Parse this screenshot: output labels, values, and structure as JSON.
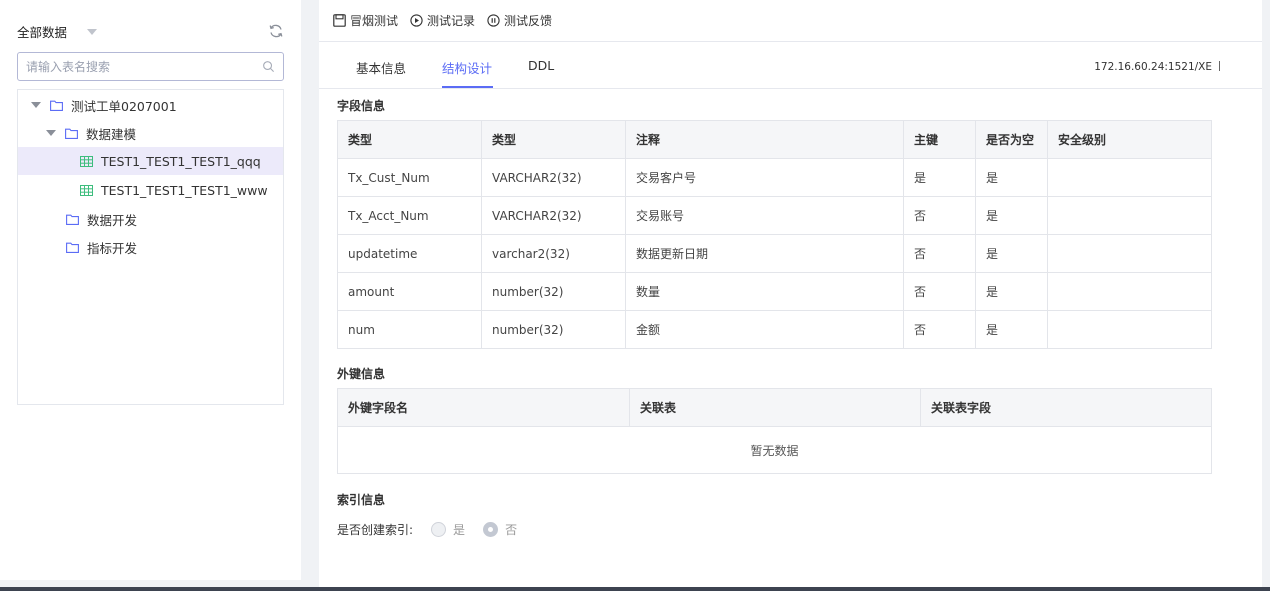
{
  "sidebar": {
    "scope_label": "全部数据",
    "search_placeholder": "请输入表名搜索",
    "tree": [
      {
        "label": "测试工单0207001",
        "type": "folder",
        "expanded": true
      },
      {
        "label": "数据建模",
        "type": "folder",
        "expanded": true
      },
      {
        "label": "TEST1_TEST1_TEST1_qqq",
        "type": "table",
        "selected": true
      },
      {
        "label": "TEST1_TEST1_TEST1_www",
        "type": "table"
      },
      {
        "label": "数据开发",
        "type": "folder"
      },
      {
        "label": "指标开发",
        "type": "folder"
      }
    ]
  },
  "toolbar": {
    "smoke_test": "冒烟测试",
    "test_record": "测试记录",
    "test_feedback": "测试反馈"
  },
  "tabs": {
    "basic": "基本信息",
    "structure": "结构设计",
    "ddl": "DDL",
    "active": "结构设计"
  },
  "connection": "172.16.60.24:1521/XE",
  "fields": {
    "title": "字段信息",
    "headers": [
      "类型",
      "类型",
      "注释",
      "主键",
      "是否为空",
      "安全级别"
    ],
    "rows": [
      [
        "Tx_Cust_Num",
        "VARCHAR2(32)",
        "交易客户号",
        "是",
        "是",
        ""
      ],
      [
        "Tx_Acct_Num",
        "VARCHAR2(32)",
        "交易账号",
        "否",
        "是",
        ""
      ],
      [
        "updatetime",
        "varchar2(32)",
        "数据更新日期",
        "否",
        "是",
        ""
      ],
      [
        "amount",
        "number(32)",
        "数量",
        "否",
        "是",
        ""
      ],
      [
        "num",
        "number(32)",
        "金额",
        "否",
        "是",
        ""
      ]
    ]
  },
  "foreign_keys": {
    "title": "外键信息",
    "headers": [
      "外键字段名",
      "关联表",
      "关联表字段"
    ],
    "empty_text": "暂无数据"
  },
  "index": {
    "title": "索引信息",
    "create_label": "是否创建索引:",
    "option_yes": "是",
    "option_no": "否",
    "selected": "否"
  },
  "colors": {
    "accent": "#5b6cf5",
    "selected_row": "#eceafa",
    "table_icon": "#3dbd7d"
  }
}
